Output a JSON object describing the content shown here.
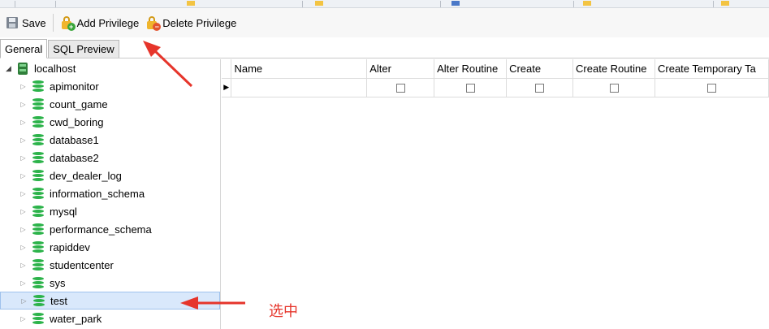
{
  "toolbar": {
    "save_label": "Save",
    "add_privilege_label": "Add Privilege",
    "delete_privilege_label": "Delete Privilege"
  },
  "tabs": [
    {
      "label": "General",
      "active": true
    },
    {
      "label": "SQL Preview",
      "active": false
    }
  ],
  "tree": {
    "root": "localhost",
    "databases": [
      "apimonitor",
      "count_game",
      "cwd_boring",
      "database1",
      "database2",
      "dev_dealer_log",
      "information_schema",
      "mysql",
      "performance_schema",
      "rapiddev",
      "studentcenter",
      "sys",
      "test",
      "water_park"
    ],
    "selected": "test"
  },
  "grid": {
    "columns": [
      "Name",
      "Alter",
      "Alter Routine",
      "Create",
      "Create Routine",
      "Create Temporary Ta"
    ],
    "rows": [
      {
        "name": "",
        "checks": [
          false,
          false,
          false,
          false,
          false
        ]
      }
    ]
  },
  "annotation": {
    "text": "选中",
    "color": "#e6352b"
  },
  "colors": {
    "db_icon": "#2cb34a",
    "selection_bg": "#d9e8fb",
    "lock_icon": "#f0b52c"
  }
}
